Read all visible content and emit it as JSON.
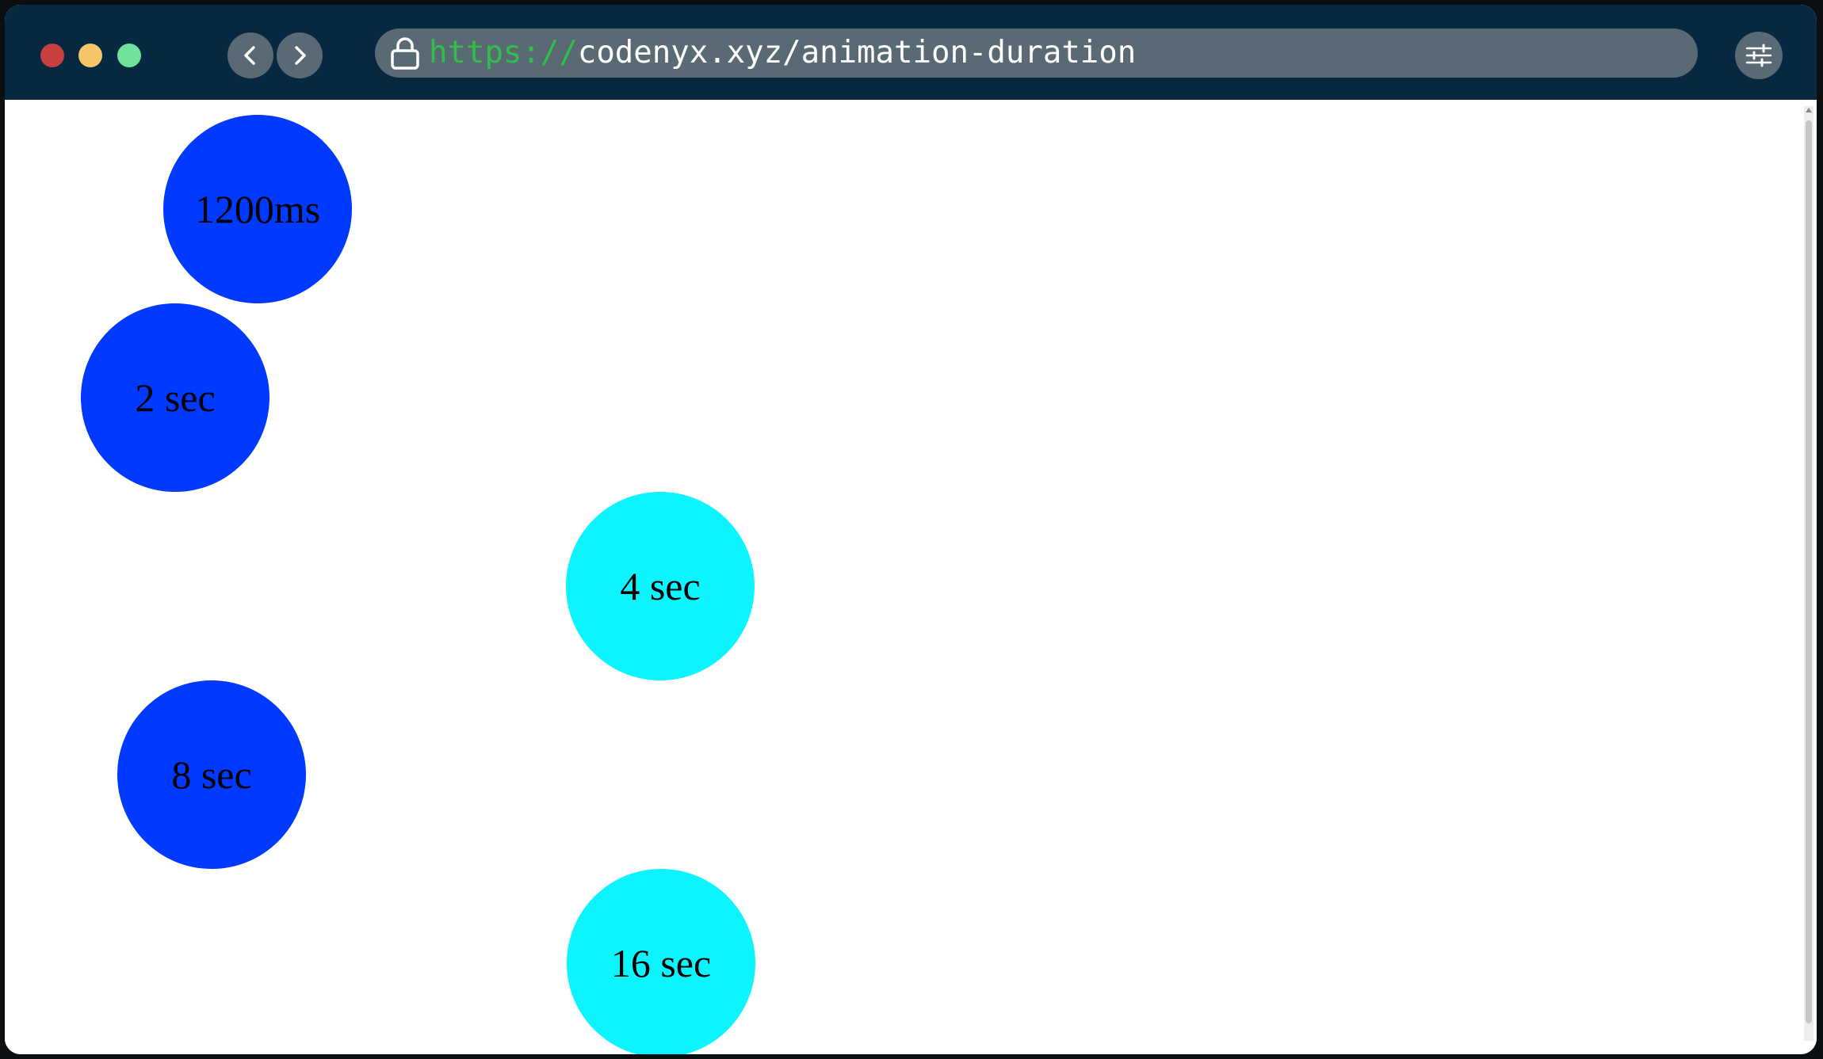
{
  "browser": {
    "url_scheme": "https://",
    "url_rest": "codenyx.xyz/animation-duration",
    "icons": {
      "back": "chevron-left-icon",
      "forward": "chevron-right-icon",
      "lock": "lock-icon",
      "settings": "sliders-icon"
    }
  },
  "colors": {
    "titlebar": "#072841",
    "blue_circle": "#0039ff",
    "cyan_circle": "#0cf5ff"
  },
  "circles": [
    {
      "label": "1200ms",
      "color": "#0039ff"
    },
    {
      "label": "2 sec",
      "color": "#0039ff"
    },
    {
      "label": "4 sec",
      "color": "#0cf5ff"
    },
    {
      "label": "8 sec",
      "color": "#0039ff"
    },
    {
      "label": "16 sec",
      "color": "#0cf5ff"
    }
  ]
}
